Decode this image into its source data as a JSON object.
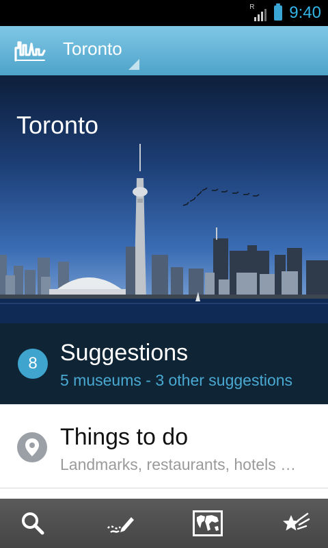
{
  "status_bar": {
    "signal_label": "R",
    "time": "9:40"
  },
  "action_bar": {
    "logo_icon": "city-skyline-icon",
    "city_name": "Toronto"
  },
  "hero": {
    "title": "Toronto",
    "image": "toronto-skyline-photo"
  },
  "suggestions": {
    "count": "8",
    "title": "Suggestions",
    "subtitle": "5 museums - 3 other suggestions"
  },
  "things_to_do": {
    "icon": "map-pin-icon",
    "title": "Things to do",
    "subtitle": "Landmarks, restaurants, hotels …"
  },
  "bottom_bar": {
    "tabs": [
      {
        "icon": "search-icon"
      },
      {
        "icon": "journal-pencil-icon"
      },
      {
        "icon": "world-map-icon"
      },
      {
        "icon": "favorites-star-icon"
      }
    ]
  },
  "colors": {
    "accent": "#33b5e5",
    "action_bar": "#5fb1d6",
    "suggestions_bg": "#0f2535",
    "badge": "#3fa5cf"
  }
}
